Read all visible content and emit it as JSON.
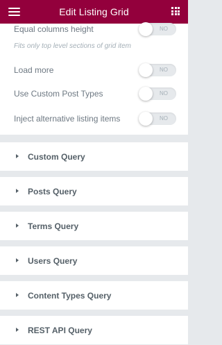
{
  "header": {
    "title": "Edit Listing Grid",
    "menu_icon": "hamburger-menu-icon",
    "apps_icon": "grid-apps-icon",
    "background": "#93003c"
  },
  "settings": {
    "equal_columns": {
      "label": "Equal columns height",
      "value": "NO",
      "hint": "Fits only top level sections of grid item"
    },
    "load_more": {
      "label": "Load more",
      "value": "NO"
    },
    "custom_post_types": {
      "label": "Use Custom Post Types",
      "value": "NO"
    },
    "inject_items": {
      "label": "Inject alternative listing items",
      "value": "NO"
    }
  },
  "sections": [
    {
      "label": "Custom Query"
    },
    {
      "label": "Posts Query"
    },
    {
      "label": "Terms Query"
    },
    {
      "label": "Users Query"
    },
    {
      "label": "Content Types Query"
    },
    {
      "label": "REST API Query"
    }
  ]
}
